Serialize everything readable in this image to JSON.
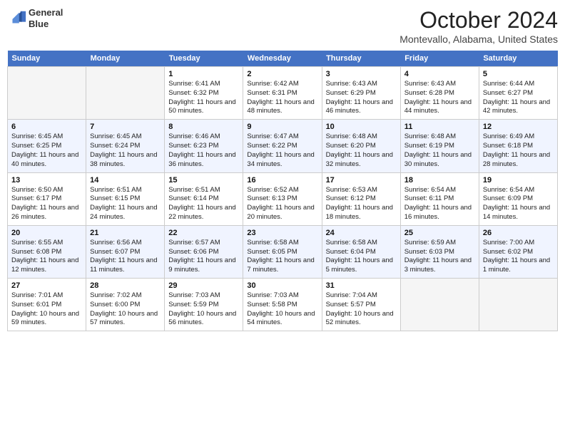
{
  "header": {
    "logo_line1": "General",
    "logo_line2": "Blue",
    "month": "October 2024",
    "location": "Montevallo, Alabama, United States"
  },
  "days_of_week": [
    "Sunday",
    "Monday",
    "Tuesday",
    "Wednesday",
    "Thursday",
    "Friday",
    "Saturday"
  ],
  "weeks": [
    [
      {
        "num": "",
        "info": ""
      },
      {
        "num": "",
        "info": ""
      },
      {
        "num": "1",
        "info": "Sunrise: 6:41 AM\nSunset: 6:32 PM\nDaylight: 11 hours and 50 minutes."
      },
      {
        "num": "2",
        "info": "Sunrise: 6:42 AM\nSunset: 6:31 PM\nDaylight: 11 hours and 48 minutes."
      },
      {
        "num": "3",
        "info": "Sunrise: 6:43 AM\nSunset: 6:29 PM\nDaylight: 11 hours and 46 minutes."
      },
      {
        "num": "4",
        "info": "Sunrise: 6:43 AM\nSunset: 6:28 PM\nDaylight: 11 hours and 44 minutes."
      },
      {
        "num": "5",
        "info": "Sunrise: 6:44 AM\nSunset: 6:27 PM\nDaylight: 11 hours and 42 minutes."
      }
    ],
    [
      {
        "num": "6",
        "info": "Sunrise: 6:45 AM\nSunset: 6:25 PM\nDaylight: 11 hours and 40 minutes."
      },
      {
        "num": "7",
        "info": "Sunrise: 6:45 AM\nSunset: 6:24 PM\nDaylight: 11 hours and 38 minutes."
      },
      {
        "num": "8",
        "info": "Sunrise: 6:46 AM\nSunset: 6:23 PM\nDaylight: 11 hours and 36 minutes."
      },
      {
        "num": "9",
        "info": "Sunrise: 6:47 AM\nSunset: 6:22 PM\nDaylight: 11 hours and 34 minutes."
      },
      {
        "num": "10",
        "info": "Sunrise: 6:48 AM\nSunset: 6:20 PM\nDaylight: 11 hours and 32 minutes."
      },
      {
        "num": "11",
        "info": "Sunrise: 6:48 AM\nSunset: 6:19 PM\nDaylight: 11 hours and 30 minutes."
      },
      {
        "num": "12",
        "info": "Sunrise: 6:49 AM\nSunset: 6:18 PM\nDaylight: 11 hours and 28 minutes."
      }
    ],
    [
      {
        "num": "13",
        "info": "Sunrise: 6:50 AM\nSunset: 6:17 PM\nDaylight: 11 hours and 26 minutes."
      },
      {
        "num": "14",
        "info": "Sunrise: 6:51 AM\nSunset: 6:15 PM\nDaylight: 11 hours and 24 minutes."
      },
      {
        "num": "15",
        "info": "Sunrise: 6:51 AM\nSunset: 6:14 PM\nDaylight: 11 hours and 22 minutes."
      },
      {
        "num": "16",
        "info": "Sunrise: 6:52 AM\nSunset: 6:13 PM\nDaylight: 11 hours and 20 minutes."
      },
      {
        "num": "17",
        "info": "Sunrise: 6:53 AM\nSunset: 6:12 PM\nDaylight: 11 hours and 18 minutes."
      },
      {
        "num": "18",
        "info": "Sunrise: 6:54 AM\nSunset: 6:11 PM\nDaylight: 11 hours and 16 minutes."
      },
      {
        "num": "19",
        "info": "Sunrise: 6:54 AM\nSunset: 6:09 PM\nDaylight: 11 hours and 14 minutes."
      }
    ],
    [
      {
        "num": "20",
        "info": "Sunrise: 6:55 AM\nSunset: 6:08 PM\nDaylight: 11 hours and 12 minutes."
      },
      {
        "num": "21",
        "info": "Sunrise: 6:56 AM\nSunset: 6:07 PM\nDaylight: 11 hours and 11 minutes."
      },
      {
        "num": "22",
        "info": "Sunrise: 6:57 AM\nSunset: 6:06 PM\nDaylight: 11 hours and 9 minutes."
      },
      {
        "num": "23",
        "info": "Sunrise: 6:58 AM\nSunset: 6:05 PM\nDaylight: 11 hours and 7 minutes."
      },
      {
        "num": "24",
        "info": "Sunrise: 6:58 AM\nSunset: 6:04 PM\nDaylight: 11 hours and 5 minutes."
      },
      {
        "num": "25",
        "info": "Sunrise: 6:59 AM\nSunset: 6:03 PM\nDaylight: 11 hours and 3 minutes."
      },
      {
        "num": "26",
        "info": "Sunrise: 7:00 AM\nSunset: 6:02 PM\nDaylight: 11 hours and 1 minute."
      }
    ],
    [
      {
        "num": "27",
        "info": "Sunrise: 7:01 AM\nSunset: 6:01 PM\nDaylight: 10 hours and 59 minutes."
      },
      {
        "num": "28",
        "info": "Sunrise: 7:02 AM\nSunset: 6:00 PM\nDaylight: 10 hours and 57 minutes."
      },
      {
        "num": "29",
        "info": "Sunrise: 7:03 AM\nSunset: 5:59 PM\nDaylight: 10 hours and 56 minutes."
      },
      {
        "num": "30",
        "info": "Sunrise: 7:03 AM\nSunset: 5:58 PM\nDaylight: 10 hours and 54 minutes."
      },
      {
        "num": "31",
        "info": "Sunrise: 7:04 AM\nSunset: 5:57 PM\nDaylight: 10 hours and 52 minutes."
      },
      {
        "num": "",
        "info": ""
      },
      {
        "num": "",
        "info": ""
      }
    ]
  ]
}
